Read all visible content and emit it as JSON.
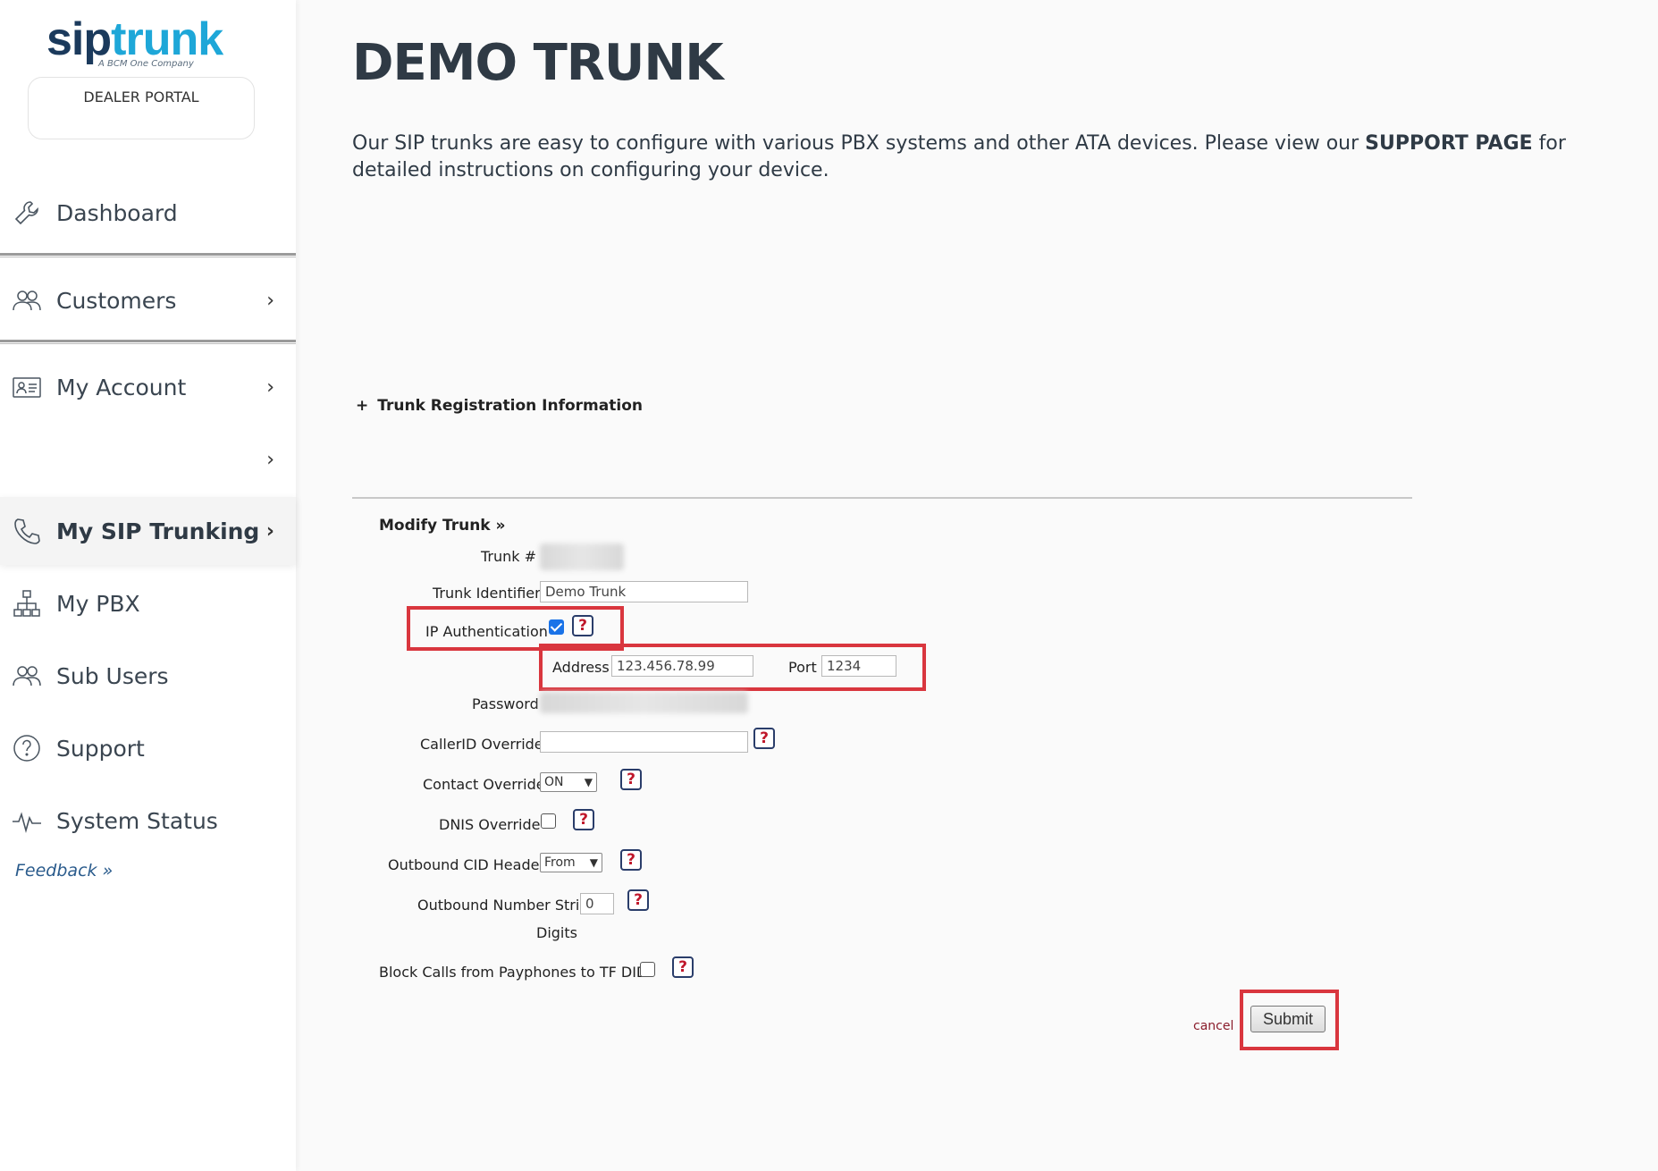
{
  "brand": {
    "logo_sip": "sip",
    "logo_trunk": "trunk",
    "tagline": "A BCM One Company",
    "portal_label": "DEALER PORTAL"
  },
  "sidebar": {
    "items": [
      {
        "label": "Dashboard",
        "icon": "wrench-icon"
      },
      {
        "label": "Customers",
        "icon": "users-icon"
      },
      {
        "label": "My Account",
        "icon": "id-card-icon"
      },
      {
        "label": "",
        "icon": ""
      },
      {
        "label": "My SIP Trunking",
        "icon": "phone-icon",
        "active": true
      },
      {
        "label": "My PBX",
        "icon": "org-chart-icon"
      },
      {
        "label": "Sub Users",
        "icon": "users-icon"
      },
      {
        "label": "Support",
        "icon": "question-circle-icon"
      },
      {
        "label": "System Status",
        "icon": "pulse-icon"
      }
    ],
    "chevron": "›",
    "feedback": "Feedback »"
  },
  "main": {
    "title": "DEMO TRUNK",
    "intro_before": "Our SIP trunks are easy to configure with various PBX systems and other ATA devices. Please view our ",
    "intro_link": "SUPPORT PAGE",
    "intro_after": " for detailed instructions on configuring your device.",
    "registration_toggle": "Trunk Registration Information",
    "registration_plus": "+"
  },
  "form": {
    "title": "Modify Trunk »",
    "trunk_number_label": "Trunk #",
    "trunk_identifier_label": "Trunk Identifier",
    "trunk_identifier_value": "Demo Trunk",
    "ip_auth_label": "IP Authentication",
    "ip_auth_checked": true,
    "address_label": "Address",
    "address_value": "123.456.78.99",
    "port_label": "Port",
    "port_value": "1234",
    "password_label": "Password",
    "callerid_label": "CallerID Override",
    "callerid_value": "",
    "contact_override_label": "Contact Override",
    "contact_override_value": "ON",
    "dnis_override_label": "DNIS Override",
    "outbound_cid_label": "Outbound CID Header",
    "outbound_cid_value": "From",
    "outbound_strip_label": "Outbound Number Strip",
    "outbound_strip_value": "0",
    "outbound_strip_suffix": "Digits",
    "block_payphones_label": "Block Calls from Payphones to TF DIDs",
    "help_glyph": "?",
    "cancel_label": "cancel",
    "submit_label": "Submit"
  },
  "colors": {
    "highlight": "#d9363e",
    "brand_dark": "#1b3a5c",
    "brand_light": "#1ea7d8"
  }
}
